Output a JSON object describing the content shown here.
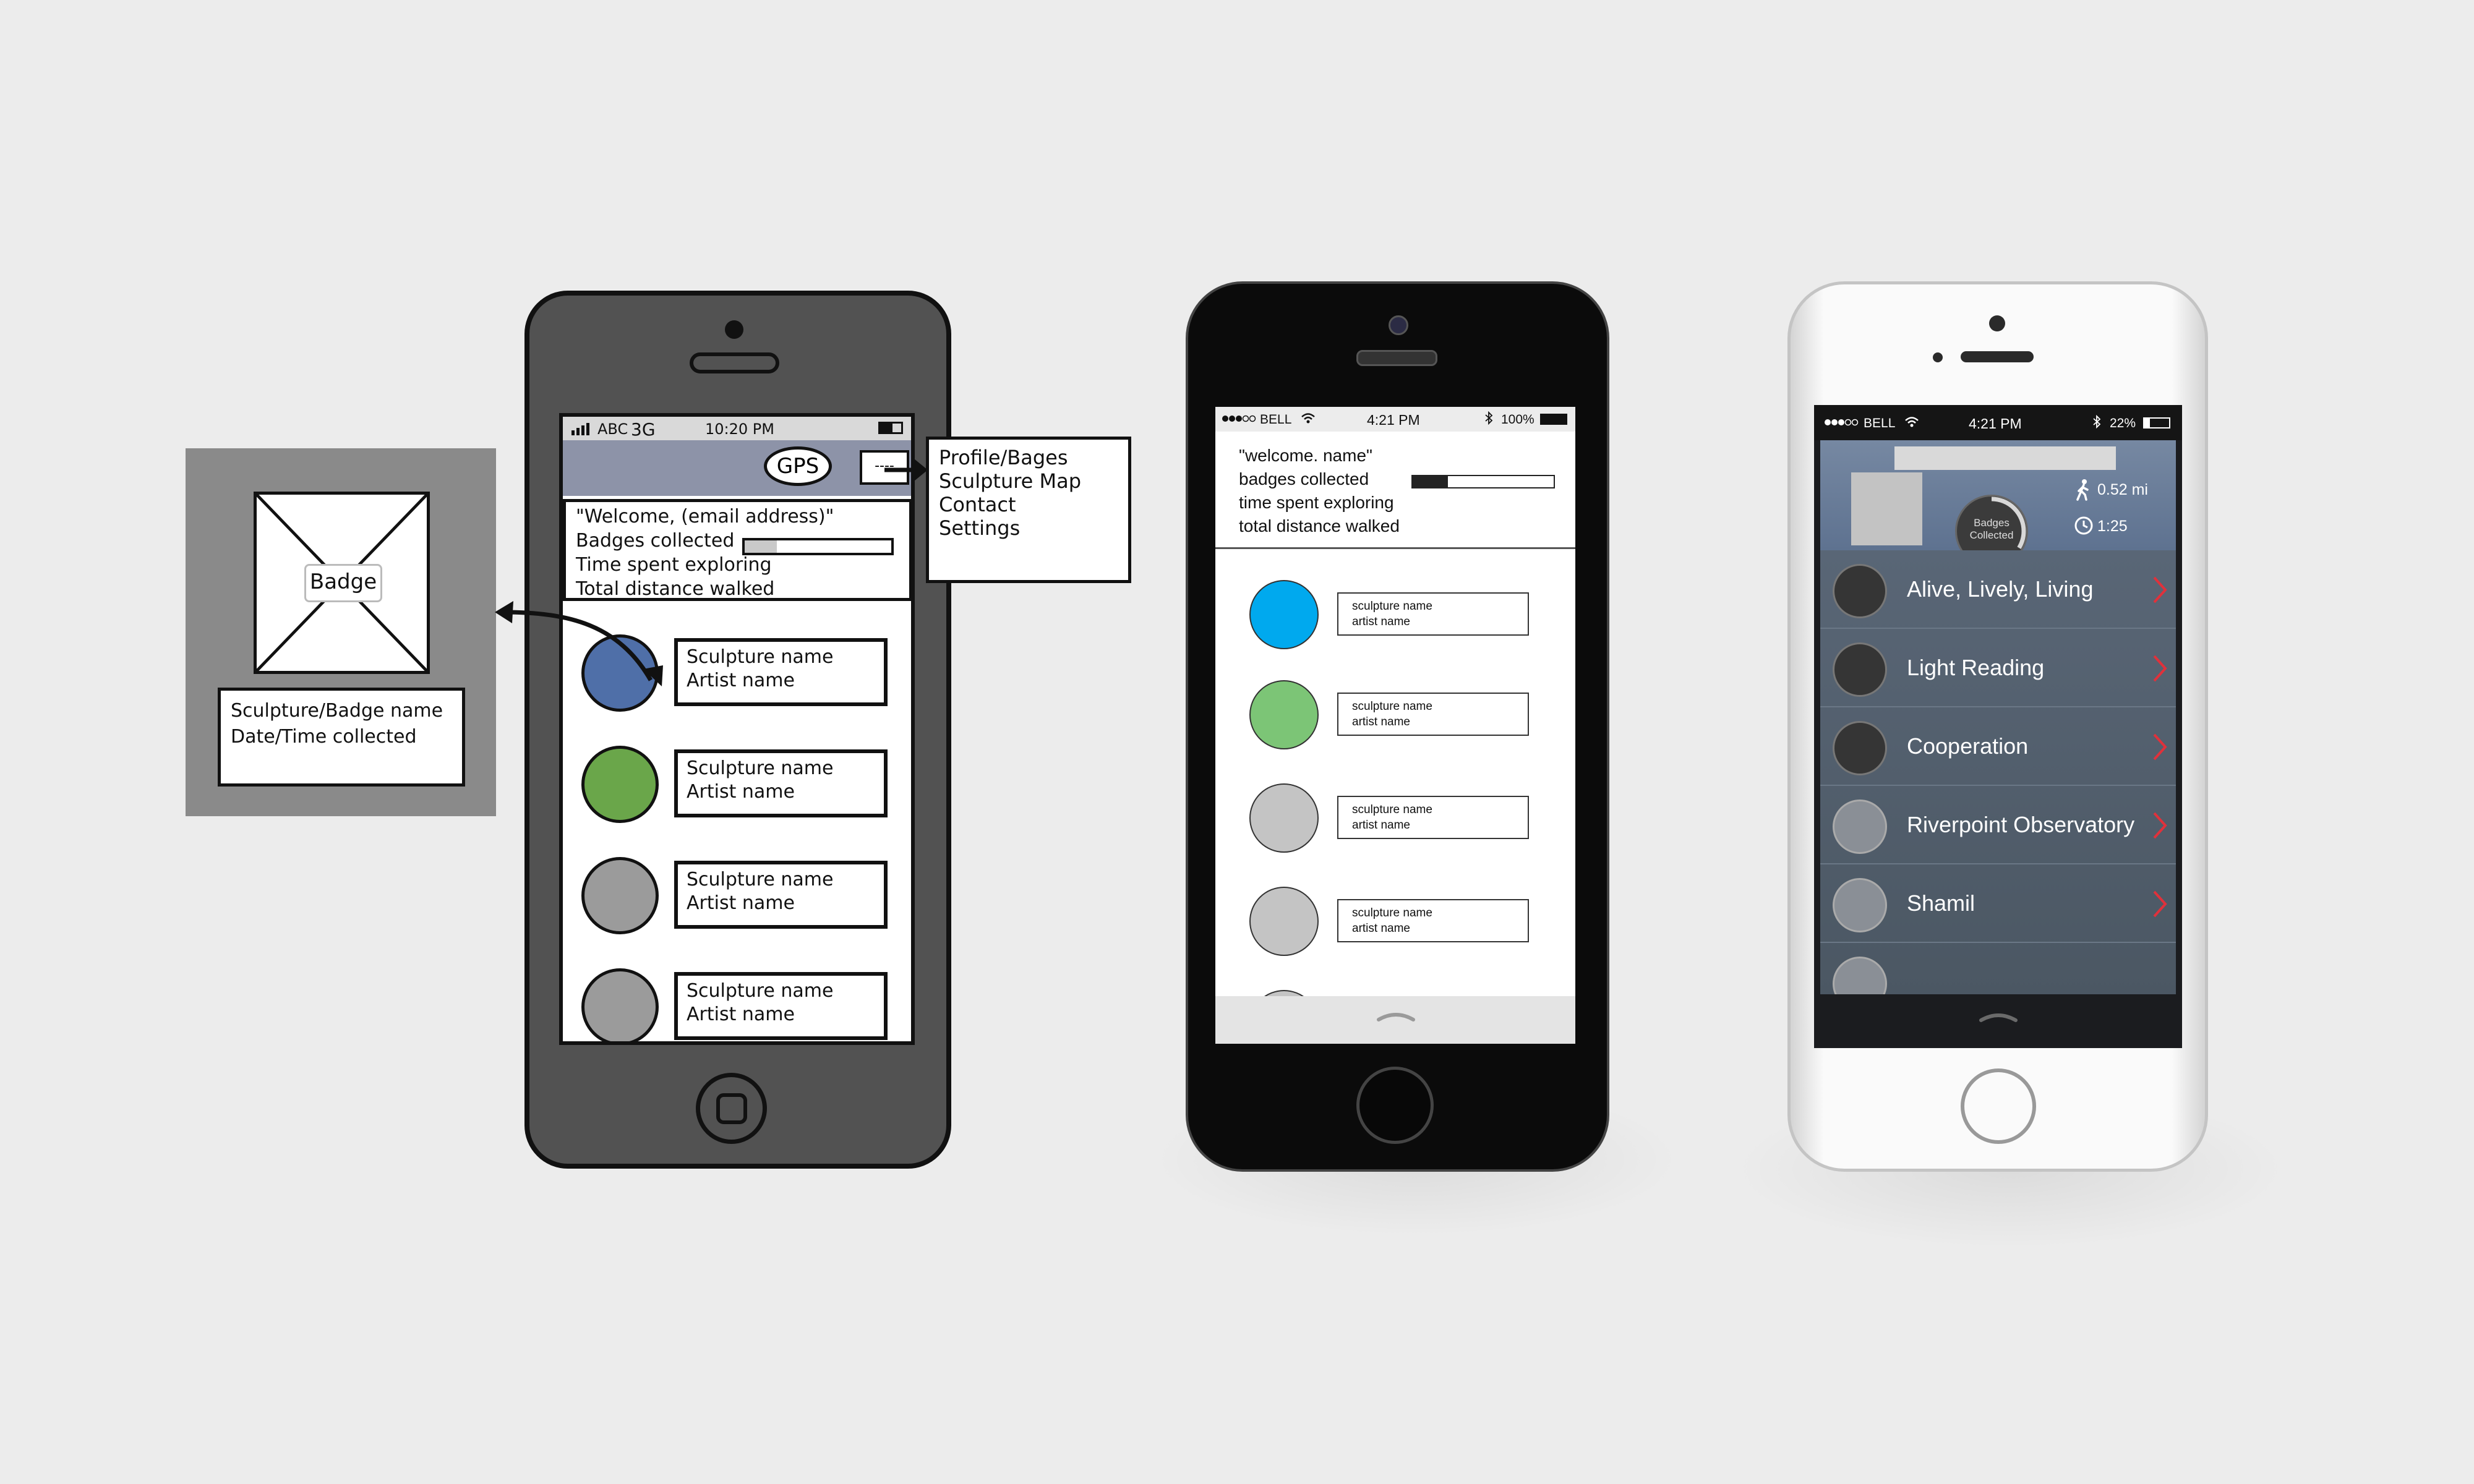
{
  "sketch": {
    "badge_label": "Badge",
    "badge_info": [
      "Sculpture/Badge name",
      "Date/Time collected"
    ],
    "status": {
      "carrier": "ABC",
      "network": "3G",
      "time": "10:20 PM"
    },
    "gps_label": "GPS",
    "menu_button": "----",
    "welcome_lines": [
      "\"Welcome, (email address)\"",
      "Badges collected",
      "Time spent exploring",
      "Total distance walked"
    ],
    "badges_progress": 0.22,
    "rows": [
      {
        "line1": "Sculpture name",
        "line2": "Artist name",
        "color": "#4f6fa8"
      },
      {
        "line1": "Sculpture name",
        "line2": "Artist name",
        "color": "#6aa64a"
      },
      {
        "line1": "Sculpture name",
        "line2": "Artist name",
        "color": "#9b9b9b"
      },
      {
        "line1": "Sculpture name",
        "line2": "Artist name",
        "color": "#9b9b9b"
      }
    ],
    "menu_items": [
      "Profile/Bages",
      "Sculpture Map",
      "Contact",
      "Settings"
    ]
  },
  "mockup": {
    "status": {
      "carrier": "BELL",
      "time": "4:21 PM",
      "battery": "100%"
    },
    "welcome_lines": [
      "\"welcome. name\"",
      "badges collected",
      "time spent exploring",
      "total distance walked"
    ],
    "badges_progress": 0.25,
    "rows": [
      {
        "line1": "sculpture name",
        "line2": "artist name",
        "color": "#00a9ee"
      },
      {
        "line1": "sculpture name",
        "line2": "artist name",
        "color": "#7cc576"
      },
      {
        "line1": "sculpture name",
        "line2": "artist name",
        "color": "#c4c4c4"
      },
      {
        "line1": "sculpture name",
        "line2": "artist name",
        "color": "#c4c4c4"
      }
    ]
  },
  "final": {
    "status": {
      "carrier": "BELL",
      "time": "4:21 PM",
      "battery": "22%"
    },
    "badges_label": "Badges Collected",
    "distance": "0.52 mi",
    "time_spent": "1:25",
    "rows": [
      {
        "label": "Alive, Lively, Living",
        "collected": true
      },
      {
        "label": "Light Reading",
        "collected": true
      },
      {
        "label": "Cooperation",
        "collected": true
      },
      {
        "label": "Riverpoint Observatory",
        "collected": false
      },
      {
        "label": "Shamil",
        "collected": false
      }
    ],
    "accent": "#e0313b"
  }
}
